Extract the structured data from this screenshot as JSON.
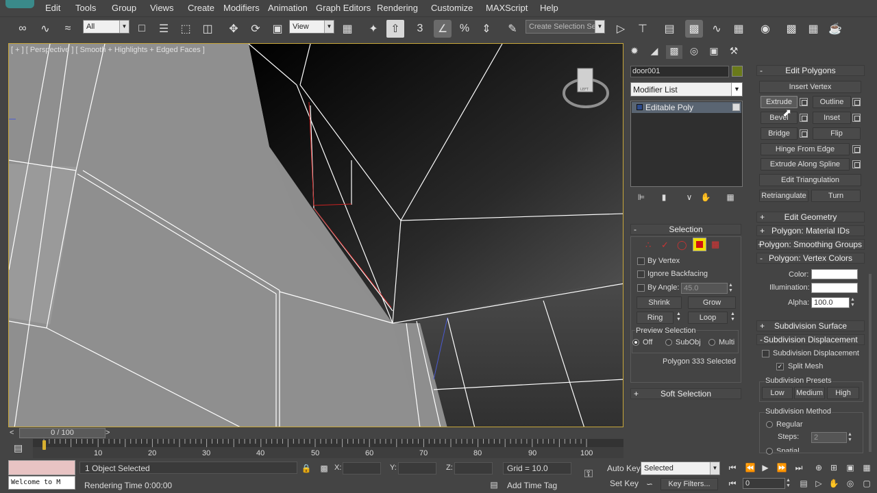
{
  "menu": [
    "Edit",
    "Tools",
    "Group",
    "Views",
    "Create",
    "Modifiers",
    "Animation",
    "Graph Editors",
    "Rendering",
    "Customize",
    "MAXScript",
    "Help"
  ],
  "toolbar": {
    "filter_value": "All",
    "refcoord_value": "View",
    "selection_set_placeholder": "Create Selection Se",
    "snap_label": "3"
  },
  "viewport": {
    "label": "[ + ] [ Perspective ] [ Smooth + Highlights + Edged Faces ]"
  },
  "command_panel": {
    "object_name": "door001",
    "object_color": "#6a7a1a",
    "modifier_list": "Modifier List",
    "stack_item": "Editable Poly",
    "selection": {
      "title": "Selection",
      "by_vertex": "By Vertex",
      "ignore_backfacing": "Ignore Backfacing",
      "by_angle": "By Angle:",
      "by_angle_value": "45.0",
      "shrink": "Shrink",
      "grow": "Grow",
      "ring": "Ring",
      "loop": "Loop",
      "preview_selection": "Preview Selection",
      "off": "Off",
      "subobj": "SubObj",
      "multi": "Multi",
      "status": "Polygon 333 Selected"
    },
    "soft_selection": "Soft Selection"
  },
  "rollout": {
    "edit_polygons": "Edit Polygons",
    "insert_vertex": "Insert Vertex",
    "extrude": "Extrude",
    "outline": "Outline",
    "bevel": "Bevel",
    "inset": "Inset",
    "bridge": "Bridge",
    "flip": "Flip",
    "hinge_from_edge": "Hinge From Edge",
    "extrude_along_spline": "Extrude Along Spline",
    "edit_triangulation": "Edit Triangulation",
    "retriangulate": "Retriangulate",
    "turn": "Turn",
    "edit_geometry": "Edit Geometry",
    "material_ids": "Polygon: Material IDs",
    "smoothing_groups": "Polygon: Smoothing Groups",
    "vertex_colors": "Polygon: Vertex Colors",
    "color_label": "Color:",
    "illumination_label": "Illumination:",
    "alpha_label": "Alpha:",
    "alpha_value": "100.0",
    "subdivision_surface": "Subdivision Surface",
    "subdivision_displacement": "Subdivision Displacement",
    "subdivision_displacement_chk": "Subdivision Displacement",
    "split_mesh": "Split Mesh",
    "presets_title": "Subdivision Presets",
    "low": "Low",
    "medium": "Medium",
    "high": "High",
    "method_title": "Subdivision Method",
    "regular": "Regular",
    "steps_label": "Steps:",
    "steps_value": "2",
    "spatial": "Spatial"
  },
  "timeline": {
    "frame": "0 / 100",
    "ticks": [
      "10",
      "20",
      "30",
      "40",
      "50",
      "60",
      "70",
      "80",
      "90",
      "100"
    ]
  },
  "status": {
    "listener_text": "Welcome to M",
    "selected": "1 Object Selected",
    "rendering_time": "Rendering Time  0:00:00",
    "x_label": "X:",
    "y_label": "Y:",
    "z_label": "Z:",
    "grid": "Grid = 10.0",
    "add_time_tag": "Add Time Tag",
    "auto_key": "Auto Key",
    "set_key": "Set Key",
    "key_mode": "Selected",
    "key_filters": "Key Filters...",
    "frame_value": "0"
  }
}
